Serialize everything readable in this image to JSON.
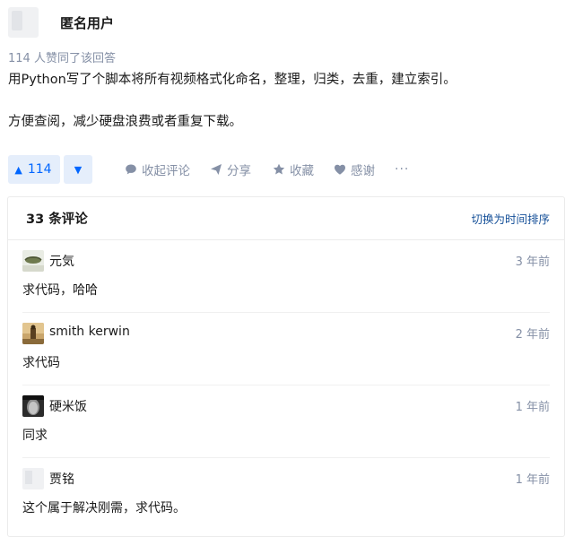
{
  "answer": {
    "author_name": "匿名用户",
    "voters_text": "114 人赞同了该回答",
    "paragraphs": [
      "用Python写了个脚本将所有视频格式化命名，整理，归类，去重，建立索引。",
      "方便查阅，减少硬盘浪费或者重复下载。"
    ]
  },
  "actions": {
    "upvote_icon": "▲",
    "upvote_count": "114",
    "downvote_icon": "▼",
    "collapse_comments": "收起评论",
    "share": "分享",
    "favorite": "收藏",
    "thank": "感谢",
    "more": "···"
  },
  "comments": {
    "title": "33 条评论",
    "sort_toggle": "切换为时间排序",
    "items": [
      {
        "name": "元気",
        "time": "3 年前",
        "text": "求代码，哈哈"
      },
      {
        "name": "smith kerwin",
        "time": "2 年前",
        "text": "求代码"
      },
      {
        "name": "硬米饭",
        "time": "1 年前",
        "text": "同求"
      },
      {
        "name": "贾铭",
        "time": "1 年前",
        "text": "这个属于解决刚需，求代码。"
      }
    ]
  },
  "colors": {
    "accent": "#0066ff",
    "accent_bg": "#e5eefb",
    "muted": "#8590a6",
    "link": "#175199"
  }
}
